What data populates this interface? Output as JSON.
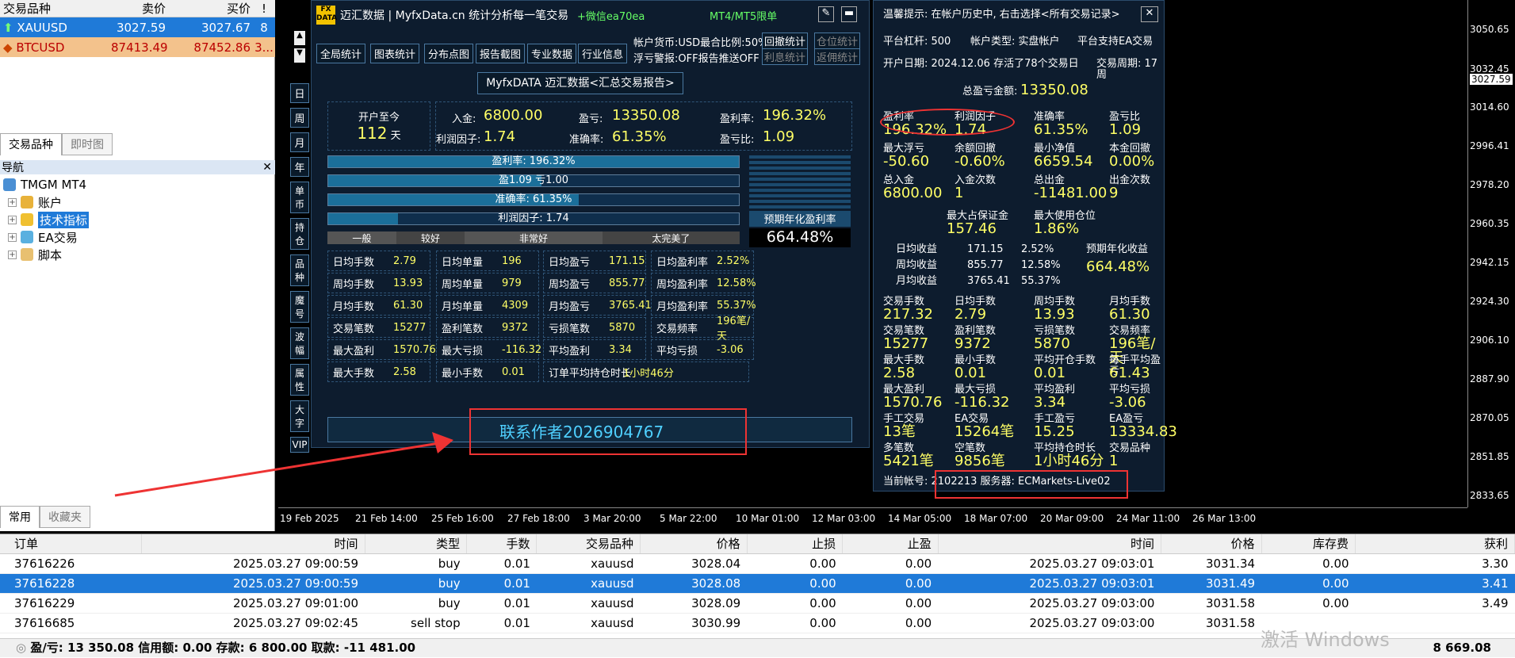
{
  "market_watch": {
    "headers": [
      "交易品种",
      "卖价",
      "买价",
      "!"
    ],
    "rows": [
      {
        "symbol": "XAUUSD",
        "bid": "3027.59",
        "ask": "3027.67",
        "spread": "8"
      },
      {
        "symbol": "BTCUSD",
        "bid": "87413.49",
        "ask": "87452.86",
        "spread": "3..."
      }
    ],
    "tabs": [
      "交易品种",
      "即时图"
    ]
  },
  "navigator": {
    "title": "导航",
    "root": "TMGM MT4",
    "items": [
      "账户",
      "技术指标",
      "EA交易",
      "脚本"
    ],
    "tabs": [
      "常用",
      "收藏夹"
    ]
  },
  "chart": {
    "y_ticks": [
      "3050.65",
      "3032.45",
      "3027.59",
      "3014.60",
      "2996.41",
      "2978.20",
      "2960.35",
      "2942.15",
      "2924.30",
      "2906.10",
      "2887.90",
      "2870.05",
      "2851.85",
      "2833.65"
    ],
    "x_ticks": [
      "19 Feb 2025",
      "21 Feb 14:00",
      "25 Feb 16:00",
      "27 Feb 18:00",
      "3 Mar 20:00",
      "5 Mar 22:00",
      "10 Mar 01:00",
      "12 Mar 03:00",
      "14 Mar 05:00",
      "18 Mar 07:00",
      "20 Mar 09:00",
      "24 Mar 11:00",
      "26 Mar 13:00"
    ]
  },
  "panel": {
    "title": "迈汇数据 | MyfxData.cn  统计分析每一笔交易",
    "wechat": "+微信ea70ea",
    "badge": "MT4/MT5限单",
    "nav_buttons": [
      "全局统计",
      "图表统计",
      "分布点图",
      "报告截图",
      "专业数据",
      "行业信息"
    ],
    "info1": "帐户货币:USD",
    "info1b": "最合比例:50%",
    "info2": "浮亏警报:OFF",
    "info2b": "报告推送OFF",
    "side_btns": [
      "回撤统计",
      "仓位统计",
      "利息统计",
      "返佣统计"
    ],
    "left_tabs": [
      "日",
      "周",
      "月",
      "年",
      "单币",
      "持仓",
      "品种",
      "魔号",
      "波幅",
      "属性",
      "大字",
      "VIP"
    ],
    "report_title": "MyfxDATA 迈汇数据<汇总交易报告>",
    "since_label": "开户至今",
    "since_days": "112",
    "since_unit": "天",
    "deposit_label": "入金:",
    "deposit": "6800.00",
    "pl_label": "盈亏:",
    "pl": "13350.08",
    "profit_rate_label": "盈利率:",
    "profit_rate": "196.32%",
    "pf_label": "利润因子:",
    "pf": "1.74",
    "win_label": "准确率:",
    "win": "61.35%",
    "ratio_label": "盈亏比:",
    "ratio": "1.09",
    "bars": [
      {
        "label": "盈利率: 196.32%",
        "fill": 1.0
      },
      {
        "label": "盈1.09",
        "label2": "亏1.00",
        "fill": 0.52
      },
      {
        "label": "准确率: 61.35%",
        "fill": 0.61
      },
      {
        "label": "利润因子: 1.74",
        "fill": 0.17
      }
    ],
    "scale": [
      "一般",
      "较好",
      "非常好",
      "太完美了"
    ],
    "annual_label": "预期年化盈利率",
    "annual": "664.48%",
    "stats": [
      [
        "日均手数",
        "2.79",
        "日均单量",
        "196",
        "日均盈亏",
        "171.15",
        "日均盈利率",
        "2.52%"
      ],
      [
        "周均手数",
        "13.93",
        "周均单量",
        "979",
        "周均盈亏",
        "855.77",
        "周均盈利率",
        "12.58%"
      ],
      [
        "月均手数",
        "61.30",
        "月均单量",
        "4309",
        "月均盈亏",
        "3765.41",
        "月均盈利率",
        "55.37%"
      ],
      [
        "交易笔数",
        "15277",
        "盈利笔数",
        "9372",
        "亏损笔数",
        "5870",
        "交易频率",
        "196笔/天"
      ],
      [
        "最大盈利",
        "1570.76",
        "最大亏损",
        "-116.32",
        "平均盈利",
        "3.34",
        "平均亏损",
        "-3.06"
      ],
      [
        "最大手数",
        "2.58",
        "最小手数",
        "0.01",
        "订单平均持仓时长",
        "1小时46分",
        "",
        ""
      ]
    ],
    "contact": "联系作者2026904767"
  },
  "rpanel": {
    "tip": "温馨提示: 在帐户历史中, 右击选择<所有交易记录>",
    "l1": "平台杠杆: 500",
    "l1b": "帐户类型: 实盘帐户",
    "l1c": "平台支持EA交易",
    "l2": "开户日期: 2024.12.06 存活了78个交易日",
    "l2b": "交易周期: 17周",
    "total_label": "总盈亏金额:",
    "total": "13350.08",
    "grid": [
      [
        "盈利率",
        "196.32%",
        "利润因子",
        "1.74",
        "准确率",
        "61.35%",
        "盈亏比",
        "1.09"
      ],
      [
        "最大浮亏",
        "-50.60",
        "余额回撤",
        "-0.60%",
        "最小净值",
        "6659.54",
        "本金回撤",
        "0.00%"
      ],
      [
        "总入金",
        "6800.00",
        "入金次数",
        "1",
        "总出金",
        "-11481.00",
        "出金次数",
        "9"
      ]
    ],
    "margin": [
      "最大占保证金",
      "157.46",
      "最大使用仓位",
      "1.86%"
    ],
    "avg": [
      [
        "日均收益",
        "171.15",
        "2.52%"
      ],
      [
        "周均收益",
        "855.77",
        "12.58%"
      ],
      [
        "月均收益",
        "3765.41",
        "55.37%"
      ]
    ],
    "annual_label": "预期年化收益",
    "annual": "664.48%",
    "grid2": [
      [
        "交易手数",
        "217.32",
        "日均手数",
        "2.79",
        "周均手数",
        "13.93",
        "月均手数",
        "61.30"
      ],
      [
        "交易笔数",
        "15277",
        "盈利笔数",
        "9372",
        "亏损笔数",
        "5870",
        "交易频率",
        "196笔/天"
      ],
      [
        "最大手数",
        "2.58",
        "最小手数",
        "0.01",
        "平均开仓手数",
        "0.01",
        "每手平均盈亏",
        "61.43"
      ],
      [
        "最大盈利",
        "1570.76",
        "最大亏损",
        "-116.32",
        "平均盈利",
        "3.34",
        "平均亏损",
        "-3.06"
      ],
      [
        "手工交易",
        "13笔",
        "EA交易",
        "15264笔",
        "手工盈亏",
        "15.25",
        "EA盈亏",
        "13334.83"
      ],
      [
        "多笔数",
        "5421笔",
        "空笔数",
        "9856笔",
        "平均持仓时长",
        "1小时46分",
        "交易品种",
        "1"
      ]
    ],
    "account": "当前帐号: 2102213 服务器: ECMarkets-Live02"
  },
  "orders": {
    "headers": [
      "订单",
      "时间",
      "类型",
      "手数",
      "交易品种",
      "价格",
      "止损",
      "止盈",
      "时间",
      "价格",
      "库存费",
      "获利"
    ],
    "rows": [
      [
        "37616226",
        "2025.03.27 09:00:59",
        "buy",
        "0.01",
        "xauusd",
        "3028.04",
        "0.00",
        "0.00",
        "2025.03.27 09:03:01",
        "3031.34",
        "0.00",
        "3.30"
      ],
      [
        "37616228",
        "2025.03.27 09:00:59",
        "buy",
        "0.01",
        "xauusd",
        "3028.08",
        "0.00",
        "0.00",
        "2025.03.27 09:03:01",
        "3031.49",
        "0.00",
        "3.41"
      ],
      [
        "37616229",
        "2025.03.27 09:01:00",
        "buy",
        "0.01",
        "xauusd",
        "3028.09",
        "0.00",
        "0.00",
        "2025.03.27 09:03:00",
        "3031.58",
        "0.00",
        "3.49"
      ],
      [
        "37616685",
        "2025.03.27 09:02:45",
        "sell stop",
        "0.01",
        "xauusd",
        "3030.99",
        "0.00",
        "0.00",
        "2025.03.27 09:03:00",
        "3031.58",
        "",
        ""
      ]
    ],
    "summary": "盈/亏: 13 350.08  信用额: 0.00  存款: 6 800.00  取款: -11 481.00",
    "total": "8 669.08"
  },
  "watermark": "激活 Windows"
}
